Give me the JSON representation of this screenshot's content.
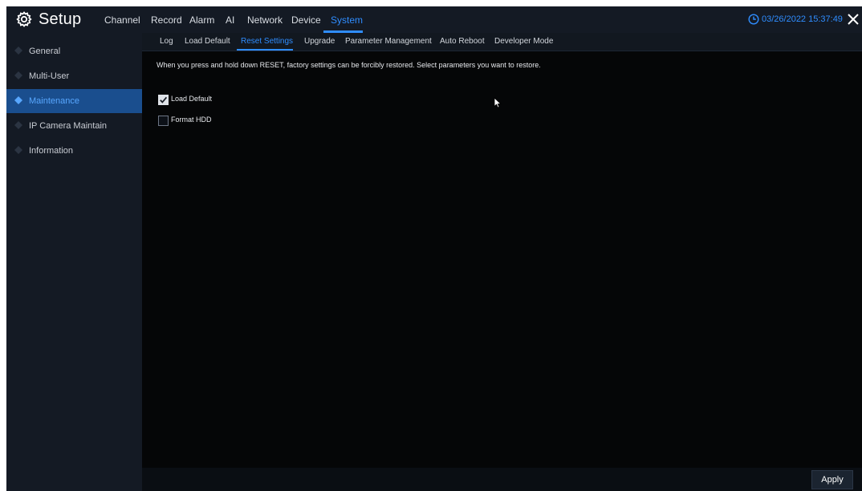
{
  "header": {
    "app_title": "Setup",
    "tabs": [
      {
        "label": "Channel",
        "active": false
      },
      {
        "label": "Record",
        "active": false
      },
      {
        "label": "Alarm",
        "active": false
      },
      {
        "label": "AI",
        "active": false
      },
      {
        "label": "Network",
        "active": false
      },
      {
        "label": "Device",
        "active": false
      },
      {
        "label": "System",
        "active": true
      }
    ],
    "datetime": "03/26/2022 15:37:49",
    "icons": {
      "settings": "gear-icon",
      "clock": "clock-icon",
      "close": "close-icon"
    }
  },
  "sidebar": {
    "items": [
      {
        "label": "General",
        "active": false
      },
      {
        "label": "Multi-User",
        "active": false
      },
      {
        "label": "Maintenance",
        "active": true
      },
      {
        "label": "IP Camera Maintain",
        "active": false
      },
      {
        "label": "Information",
        "active": false
      }
    ]
  },
  "subtabs": [
    {
      "label": "Log",
      "active": false
    },
    {
      "label": "Load Default",
      "active": false
    },
    {
      "label": "Reset Settings",
      "active": true
    },
    {
      "label": "Upgrade",
      "active": false
    },
    {
      "label": "Parameter Management",
      "active": false
    },
    {
      "label": "Auto Reboot",
      "active": false
    },
    {
      "label": "Developer Mode",
      "active": false
    }
  ],
  "main": {
    "instruction": "When you press and hold down RESET, factory settings can be forcibly restored. Select parameters you want to restore.",
    "options": [
      {
        "label": "Load Default",
        "checked": true
      },
      {
        "label": "Format HDD",
        "checked": false
      }
    ],
    "apply_label": "Apply"
  },
  "colors": {
    "accent": "#2f8dff",
    "header_bg": "#141a24",
    "content_bg": "#050607",
    "sidebar_active_bg": "#1a4e8e"
  }
}
